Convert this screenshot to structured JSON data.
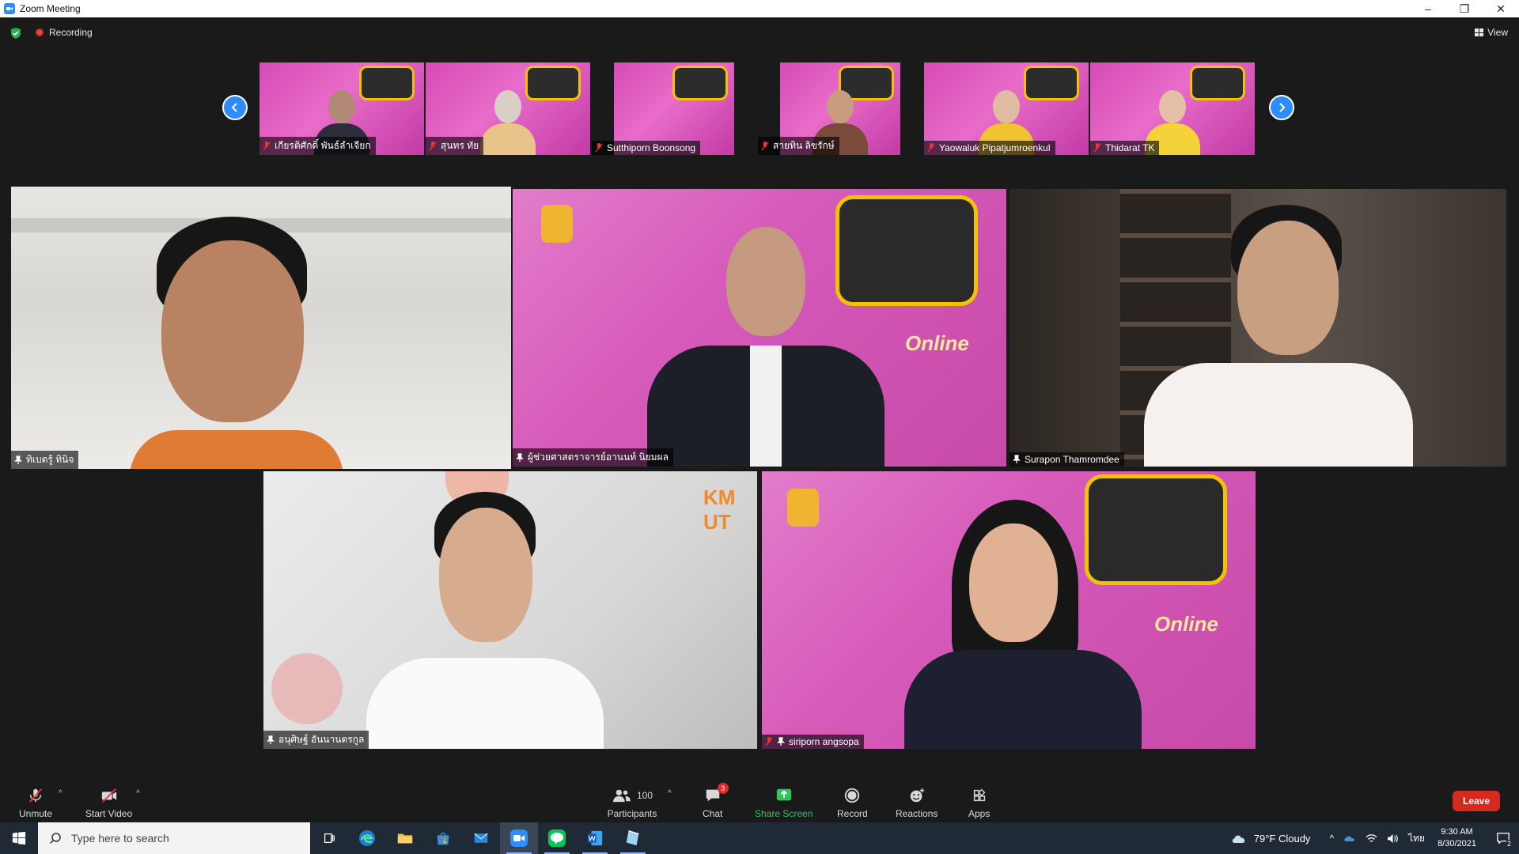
{
  "window": {
    "title": "Zoom Meeting",
    "controls": {
      "minimize": "–",
      "restore": "❐",
      "close": "✕"
    }
  },
  "meeting_bar": {
    "recording_label": "Recording",
    "view_label": "View"
  },
  "thumbnails": [
    {
      "name": "เกียรติศักดิ์ พันธ์ลำเจียก",
      "muted": true
    },
    {
      "name": "สุนทร ทัย",
      "muted": true
    },
    {
      "name": "Sutthiporn Boonsong",
      "muted": true
    },
    {
      "name": "สายทิน ลิขรักษ์",
      "muted": true
    },
    {
      "name": "Yaowaluk Pipatjumroenkul",
      "muted": true
    },
    {
      "name": "Thidarat TK",
      "muted": true
    }
  ],
  "tiles": [
    {
      "name": "ทิเบตรู้ ทินิจ",
      "pinned": true,
      "active": true
    },
    {
      "name": "ผู้ช่วยศาสตราจารย์อานนท์ นิยมผล",
      "pinned": true
    },
    {
      "name": "Surapon Thamromdee",
      "pinned": true
    },
    {
      "name": "อนุศิษฐ์ อันนานตรกูล",
      "pinned": true
    },
    {
      "name": "siriporn angsopa",
      "pinned": true,
      "muted": true
    }
  ],
  "toolbar": {
    "unmute": "Unmute",
    "start_video": "Start Video",
    "participants": "Participants",
    "participants_count": "100",
    "chat": "Chat",
    "chat_badge": "3",
    "share_screen": "Share Screen",
    "record": "Record",
    "reactions": "Reactions",
    "apps": "Apps",
    "leave": "Leave"
  },
  "taskbar": {
    "search_placeholder": "Type here to search",
    "weather": "79°F  Cloudy",
    "language": "ไทย",
    "time": "9:30 AM",
    "date": "8/30/2021",
    "notification_count": "2"
  },
  "colors": {
    "accent_blue": "#2d8cff",
    "share_green": "#33c25a",
    "leave_red": "#d52b1e",
    "active_speaker_border": "#e8e36a"
  }
}
